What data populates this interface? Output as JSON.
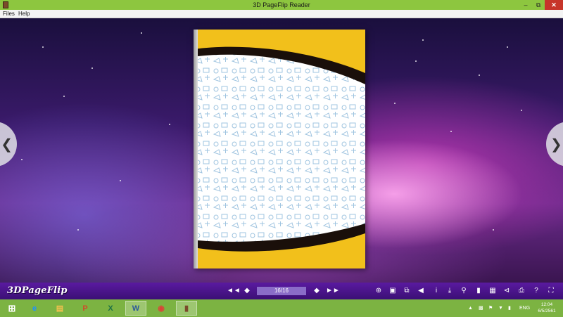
{
  "window": {
    "title": "3D PageFlip Reader",
    "min_icon": "minimize-icon",
    "max_icon": "restore-icon",
    "close_icon": "close-icon"
  },
  "menu": {
    "items": [
      "Files",
      "Help"
    ]
  },
  "viewer": {
    "prev_icon": "chevron-left-icon",
    "next_icon": "chevron-right-icon",
    "book_colors": {
      "band": "#f2c01b",
      "stripe": "#1a0f0a",
      "pattern": "#9fc4e0"
    }
  },
  "toolbar": {
    "logo": "3DPageFlip",
    "page_indicator": "16/16",
    "left_icons": [
      "first-page-icon",
      "previous-page-icon"
    ],
    "right_nav_icons": [
      "next-page-icon",
      "last-page-icon"
    ],
    "tool_icons": [
      "zoom-icon",
      "single-page-icon",
      "thumbnails-icon",
      "sound-icon",
      "info-icon",
      "download-icon",
      "search-icon",
      "bookmark-icon",
      "grid-icon",
      "share-icon",
      "print-icon",
      "help-icon",
      "fullscreen-icon"
    ]
  },
  "taskbar": {
    "apps": [
      "start-icon",
      "internet-explorer-icon",
      "file-explorer-icon",
      "powerpoint-icon",
      "excel-icon",
      "word-icon",
      "chrome-icon",
      "pageflip-reader-icon"
    ],
    "language": "ENG",
    "time": "12:04",
    "date": "6/5/2561",
    "accent": "#7cb342"
  }
}
